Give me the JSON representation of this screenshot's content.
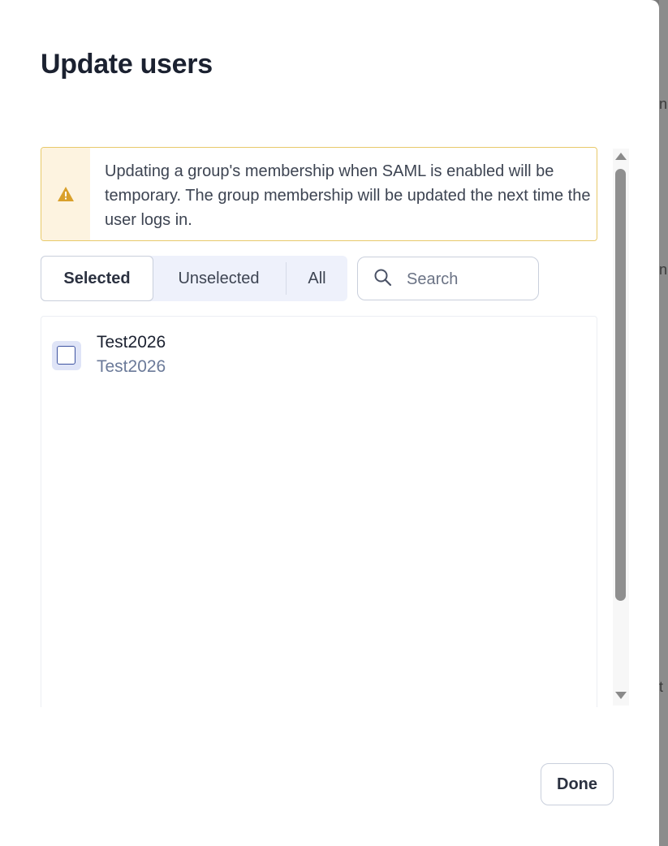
{
  "dialog": {
    "title": "Update users",
    "alert": {
      "icon": "warning-icon",
      "text": "Updating a group's membership when SAML is enabled will be temporary. The group membership will be updated the next time the user logs in.",
      "color": "#d9a02b"
    },
    "tabs": [
      {
        "label": "Selected",
        "active": true
      },
      {
        "label": "Unselected",
        "active": false
      },
      {
        "label": "All",
        "active": false
      }
    ],
    "search": {
      "placeholder": "Search",
      "value": "",
      "icon": "search-icon"
    },
    "users": [
      {
        "name": "Test2026",
        "subtitle": "Test2026",
        "checked": false
      }
    ],
    "done_label": "Done"
  },
  "backdrop": {
    "fragments": [
      "n",
      "n",
      "t"
    ]
  }
}
